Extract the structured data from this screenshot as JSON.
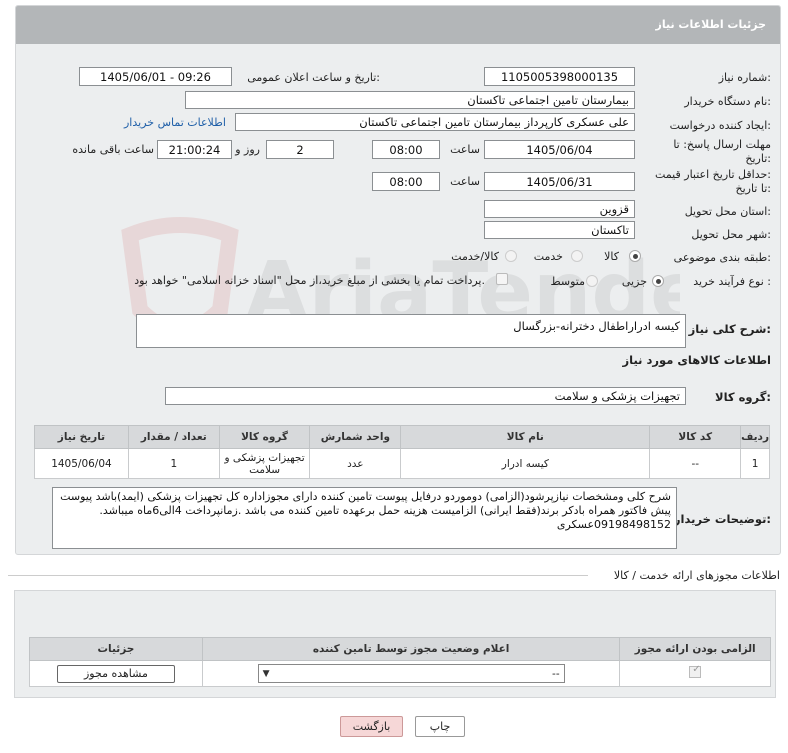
{
  "header": {
    "title": "جزئیات اطلاعات نیاز"
  },
  "form": {
    "need_number_label": "شماره نیاز:",
    "need_number": "1105005398000135",
    "announce_label": "تاریخ و ساعت اعلان عمومی:",
    "announce_value": "1405/06/01 - 09:26",
    "buyer_org_label": "نام دستگاه خریدار:",
    "buyer_org": "بیمارستان تامین اجتماعی تاکستان",
    "creator_label": "ایجاد کننده درخواست:",
    "creator": "علی عسکری کارپرداز بیمارستان تامین اجتماعی تاکستان",
    "contact_link": "اطلاعات تماس خریدار",
    "deadline_label_1": "مهلت ارسال پاسخ: تا",
    "deadline_label_2": "تاریخ:",
    "deadline_date": "1405/06/04",
    "time_label": "ساعت",
    "deadline_time": "08:00",
    "days_value": "2",
    "days_label": "روز و",
    "remaining_time": "21:00:24",
    "remaining_label": "ساعت باقی مانده",
    "validity_label_1": "حداقل تاریخ اعتبار قیمت:",
    "validity_label_2": "تا تاریخ:",
    "validity_date": "1405/06/31",
    "validity_time": "08:00",
    "province_label": "استان محل تحویل:",
    "province": "قزوین",
    "city_label": "شهر محل تحویل:",
    "city": "تاکستان",
    "category_label": "طبقه بندی موضوعی:",
    "category_options": [
      "کالا",
      "خدمت",
      "کالا/خدمت"
    ],
    "process_label": "نوع فرآیند خرید :",
    "process_options": [
      "جزیی",
      "متوسط"
    ],
    "payment_note": "پرداخت تمام یا بخشی از مبلغ خرید،از محل \"اسناد خزانه اسلامی\" خواهد بود."
  },
  "summary": {
    "label": "شرح کلی نیاز:",
    "value": "کیسه ادراراطفال دخترانه-بزرگسال"
  },
  "goods_section": {
    "title": "اطلاعات کالاهای مورد نیاز",
    "group_label": "گروه کالا:",
    "group_value": "تجهیزات پزشکی و سلامت",
    "table": {
      "headers": [
        "ردیف",
        "کد کالا",
        "نام کالا",
        "واحد شمارش",
        "گروه کالا",
        "تعداد / مقدار",
        "تاریخ نیاز"
      ],
      "rows": [
        [
          "1",
          "--",
          "کیسه ادرار",
          "عدد",
          "تجهیزات پزشکی و سلامت",
          "1",
          "1405/06/04"
        ]
      ]
    },
    "buyer_notes_label": "توضیحات خریدار:",
    "buyer_notes": "شرح کلی ومشخصات نیازپرشود(الزامی) دوموردو درفایل پیوست تامین کننده دارای مجوزاداره کل تجهیزات پزشکی (ایمد)باشد پیوست پیش فاکتور همراه بادکر برند(فقط ایرانی) الزامیست هزینه حمل برعهده تامین کننده می باشد .زمانپرداخت 4الی6ماه میباشد. 09198498152عسکری"
  },
  "permits": {
    "section_title": "اطلاعات مجوزهای ارائه خدمت / کالا",
    "headers": [
      "الزامی بودن ارائه مجوز",
      "اعلام وضعیت مجوز توسط تامین کننده",
      "جزئیات"
    ],
    "select_value": "--",
    "view_button": "مشاهده مجوز"
  },
  "actions": {
    "print": "چاپ",
    "back": "بازگشت"
  },
  "watermark": {
    "text": "AriaTender.neT"
  },
  "colors": {
    "header": "#b3b6b8",
    "panel": "#eceeef",
    "link": "#1f5fa8",
    "back_button": "#f6d7d7"
  }
}
